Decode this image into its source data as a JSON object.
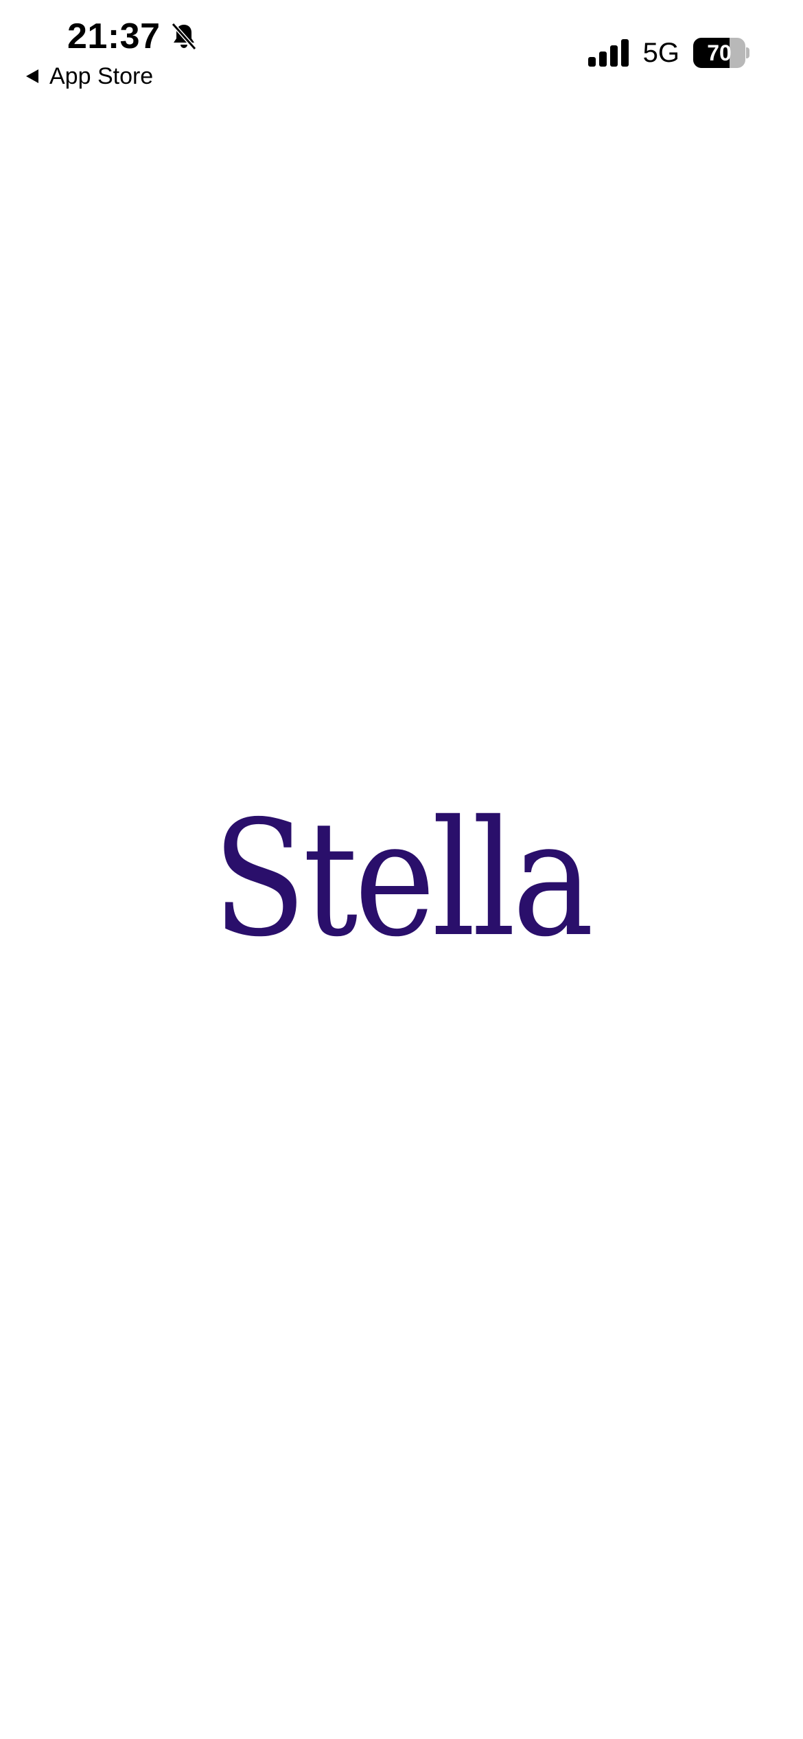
{
  "status_bar": {
    "time": "21:37",
    "back_label": "App Store",
    "network": "5G",
    "battery_level": "70",
    "battery_fraction": 0.7,
    "icons": {
      "silent": "bell-slash-icon",
      "back": "back-arrow-icon",
      "signal": "signal-bars-icon",
      "battery": "battery-icon"
    }
  },
  "splash": {
    "logo_text": "Stella",
    "logo_color": "#2a0f6b"
  },
  "colors": {
    "background": "#ffffff",
    "status_text": "#000000",
    "brand": "#2a0f6b"
  }
}
